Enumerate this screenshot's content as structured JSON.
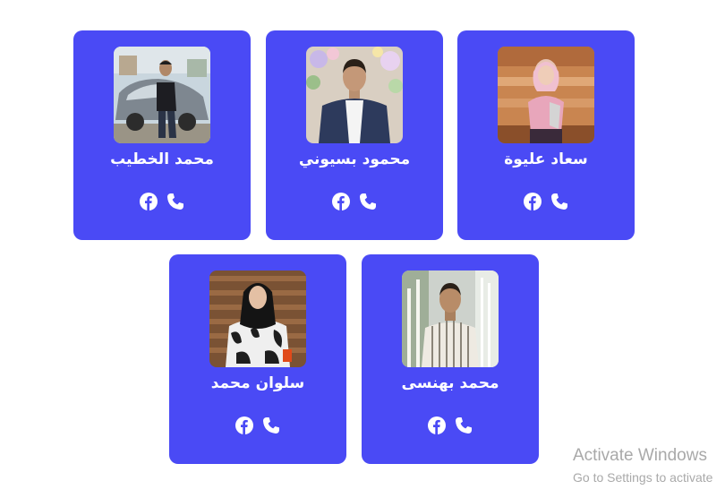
{
  "team": {
    "members": [
      {
        "name": "سعاد عليوة"
      },
      {
        "name": "محمود بسيوني"
      },
      {
        "name": "محمد الخطيب"
      },
      {
        "name": "محمد بهنسى"
      },
      {
        "name": "سلوان محمد"
      }
    ],
    "icons": [
      "facebook-icon",
      "phone-icon"
    ]
  },
  "watermark": {
    "title": "Activate Windows",
    "subtitle": "Go to Settings to activate"
  },
  "colors": {
    "card_background": "#4a4af5",
    "text": "#ffffff",
    "watermark": "#a9a9a9"
  }
}
